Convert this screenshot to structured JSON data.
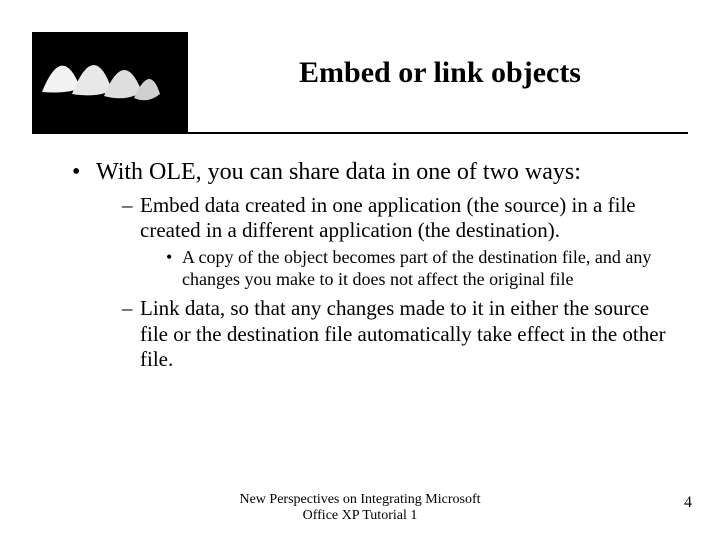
{
  "title": "Embed or link objects",
  "thumb_alt": "opera-house-silhouette",
  "bullets": {
    "l1": "With OLE, you can share data in one of two ways:",
    "l2a": "Embed data created in one application (the source) in a file created in a different application (the destination).",
    "l3a": "A copy of the object becomes part of the destination file, and any changes you make to it does not affect the original file",
    "l2b": "Link data, so that any changes made to it in either the source file or the destination file automatically take effect in the other file."
  },
  "footer": {
    "center": "New Perspectives on Integrating Microsoft Office XP Tutorial 1",
    "page": "4"
  }
}
